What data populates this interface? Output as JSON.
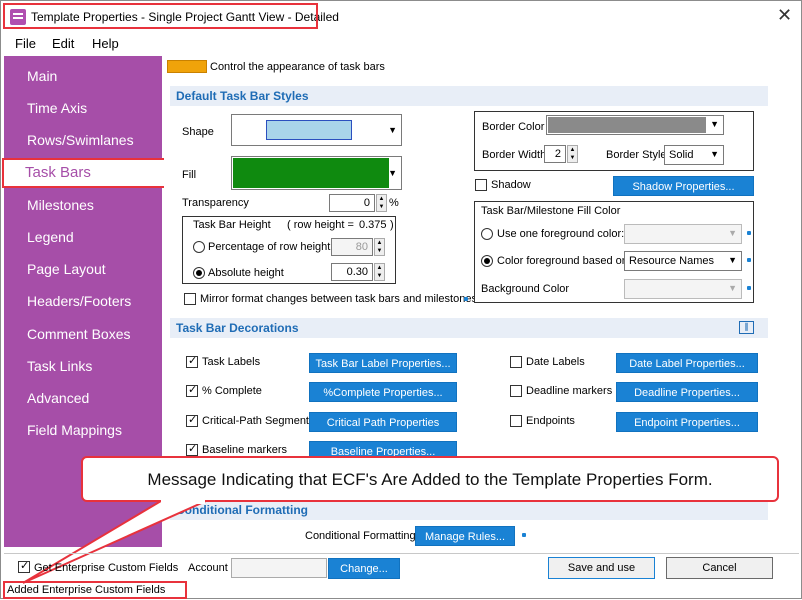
{
  "window": {
    "title": "Template Properties - Single Project Gantt View - Detailed",
    "close_glyph": "✕"
  },
  "menu": {
    "file": "File",
    "edit": "Edit",
    "help": "Help"
  },
  "sidebar": {
    "items": [
      "Main",
      "Time Axis",
      "Rows/Swimlanes",
      "Task Bars",
      "Milestones",
      "Legend",
      "Page Layout",
      "Headers/Footers",
      "Comment Boxes",
      "Task Links",
      "Advanced",
      "Field Mappings"
    ],
    "selected": "Task Bars"
  },
  "header": {
    "description": "Control the appearance of task bars",
    "accent_color": "#f0a30a"
  },
  "default_styles": {
    "section_title": "Default Task Bar Styles",
    "shape_label": "Shape",
    "fill_label": "Fill",
    "shape_color": "#a9d4ea",
    "fill_color": "#0f8a0f",
    "transparency_label": "Transparency",
    "transparency_value": "0",
    "percent": "%",
    "height_group_title": "Task Bar Height",
    "row_height_text": "( row height =",
    "row_height_value": "0.375",
    "row_height_close": ")",
    "pct_row_height_label": "Percentage of row height",
    "pct_row_height_value": "80",
    "absolute_height_label": "Absolute height",
    "absolute_height_value": "0.30",
    "mirror_label": "Mirror format changes between task bars and milestones",
    "border_color_label": "Border Color",
    "border_width_label": "Border Width",
    "border_width_value": "2",
    "border_style_label": "Border Style",
    "border_style_value": "Solid",
    "shadow_label": "Shadow",
    "shadow_button": "Shadow Properties...",
    "fill_group_title": "Task Bar/Milestone Fill Color",
    "use_one_fg_label": "Use one foreground color:",
    "color_fg_based_label": "Color foreground based on",
    "color_fg_based_value": "Resource Names",
    "background_color_label": "Background Color"
  },
  "decorations": {
    "section_title": "Task Bar Decorations",
    "task_labels": "Task Labels",
    "task_labels_btn": "Task Bar Label Properties...",
    "pct_complete": "% Complete",
    "pct_complete_btn": "%Complete Properties...",
    "critical_path": "Critical-Path Segments",
    "critical_path_btn": "Critical Path Properties",
    "baseline": "Baseline markers",
    "baseline_btn": "Baseline Properties...",
    "date_labels": "Date Labels",
    "date_labels_btn": "Date Label Properties...",
    "deadline": "Deadline markers",
    "deadline_btn": "Deadline Properties...",
    "endpoints": "Endpoints",
    "endpoints_btn": "Endpoint Properties..."
  },
  "conditional": {
    "section_title": "Conditional Formatting",
    "label": "Conditional Formatting",
    "button": "Manage Rules..."
  },
  "callout": {
    "text": "Message Indicating that ECF's Are Added to the Template Properties Form."
  },
  "footer": {
    "get_ecf_label": "Get Enterprise Custom Fields",
    "account_label": "Account",
    "change_button": "Change...",
    "save_button": "Save and use",
    "cancel_button": "Cancel"
  },
  "status": {
    "text": "Added Enterprise Custom Fields"
  }
}
